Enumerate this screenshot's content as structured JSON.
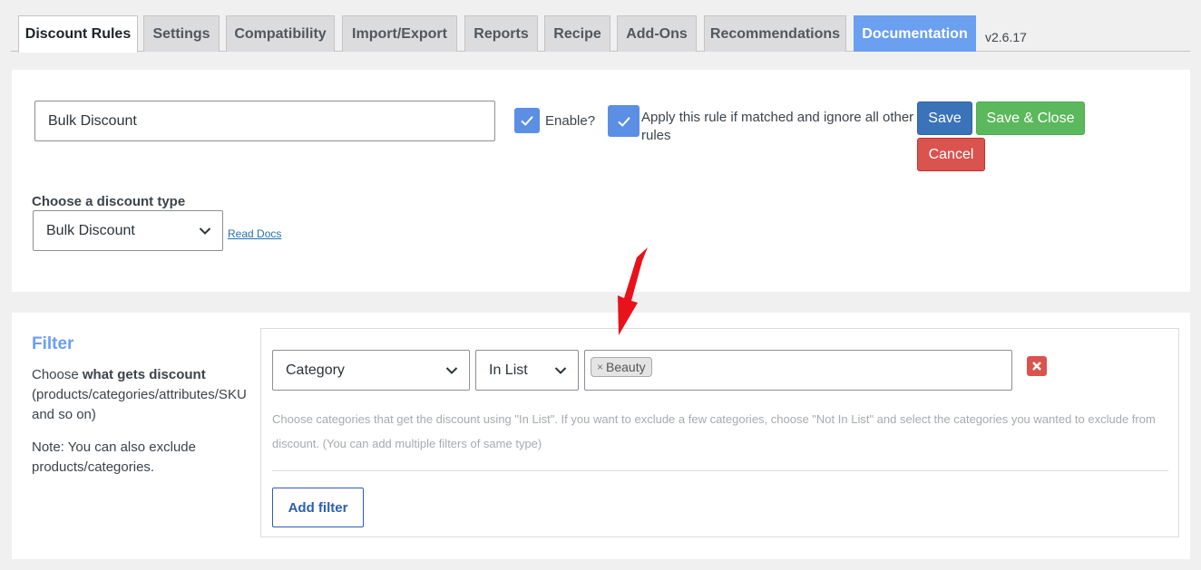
{
  "tabs": [
    {
      "label": "Discount Rules",
      "active": true
    },
    {
      "label": "Settings"
    },
    {
      "label": "Compatibility"
    },
    {
      "label": "Import/Export"
    },
    {
      "label": "Reports"
    },
    {
      "label": "Recipe"
    },
    {
      "label": "Add-Ons"
    },
    {
      "label": "Recommendations"
    },
    {
      "label": "Documentation",
      "accent": "#6b9ff0"
    }
  ],
  "version": "v2.6.17",
  "rule": {
    "name_value": "Bulk Discount",
    "enable_label": "Enable?",
    "enable_checked": true,
    "exclusive_label": "Apply this rule if matched and ignore all other rules",
    "exclusive_checked": true
  },
  "actions": {
    "save": "Save",
    "save_close": "Save & Close",
    "cancel": "Cancel"
  },
  "discount_type": {
    "label": "Choose a discount type",
    "selected": "Bulk Discount",
    "read_docs": "Read Docs"
  },
  "filter": {
    "title": "Filter",
    "desc_prefix": "Choose ",
    "desc_bold": "what gets discount",
    "desc_suffix": " (products/categories/attributes/SKU and so on)",
    "note": "Note: You can also exclude products/categories.",
    "type_selected": "Category",
    "method_selected": "In List",
    "tags": [
      "Beauty"
    ],
    "hint": "Choose categories that get the discount using \"In List\". If you want to exclude a few categories, choose \"Not In List\" and select the categories you wanted to exclude from discount. (You can add multiple filters of same type)",
    "add_filter": "Add filter"
  },
  "colors": {
    "accent_blue": "#6b9ff0",
    "save_blue": "#3a73b8",
    "save_close_green": "#5cb85c",
    "cancel_red": "#d9534f",
    "annotation_arrow": "#e8121b"
  },
  "icons": {
    "checkbox": "check-icon",
    "dropdown": "chevron-down-icon",
    "remove": "close-icon",
    "annotation": "red-arrow-icon"
  }
}
